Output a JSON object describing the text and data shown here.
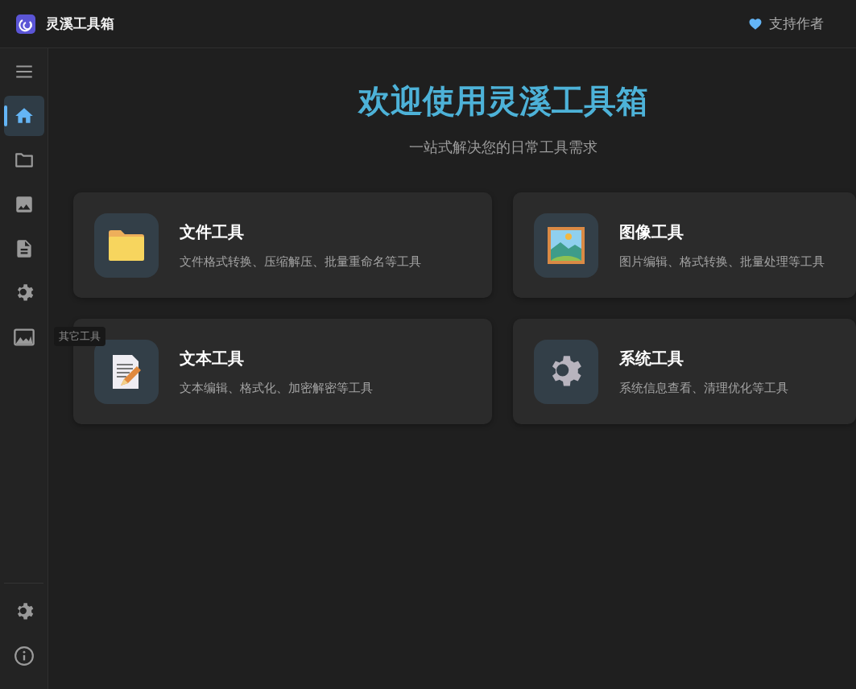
{
  "app": {
    "title": "灵溪工具箱",
    "support": "支持作者"
  },
  "sidebar": {
    "items": [
      {
        "kind": "menu",
        "selected": false
      },
      {
        "kind": "home",
        "selected": true
      },
      {
        "kind": "folder",
        "selected": false
      },
      {
        "kind": "image",
        "selected": false
      },
      {
        "kind": "document",
        "selected": false
      },
      {
        "kind": "gear",
        "selected": false
      },
      {
        "kind": "landscape",
        "selected": false,
        "tooltip": "其它工具"
      }
    ],
    "bottom_items": [
      {
        "kind": "gear"
      },
      {
        "kind": "info"
      }
    ]
  },
  "hero": {
    "title": "欢迎使用灵溪工具箱",
    "subtitle": "一站式解决您的日常工具需求"
  },
  "cards": [
    {
      "kind": "folder",
      "title": "文件工具",
      "description": "文件格式转换、压缩解压、批量重命名等工具"
    },
    {
      "kind": "picture",
      "title": "图像工具",
      "description": "图片编辑、格式转换、批量处理等工具"
    },
    {
      "kind": "memo",
      "title": "文本工具",
      "description": "文本编辑、格式化、加密解密等工具"
    },
    {
      "kind": "gear",
      "title": "系统工具",
      "description": "系统信息查看、清理优化等工具"
    }
  ]
}
